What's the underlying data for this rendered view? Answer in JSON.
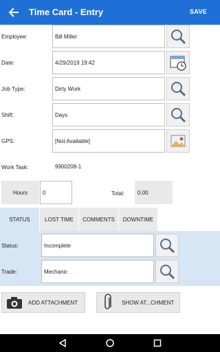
{
  "header": {
    "title": "Time Card - Entry",
    "save_label": "SAVE"
  },
  "form": {
    "employee": {
      "label": "Employee:",
      "value": "Bill Miller"
    },
    "date": {
      "label": "Date:",
      "value": "4/29/2019 19:42"
    },
    "job_type": {
      "label": "Job Type:",
      "value": "Dirty Work"
    },
    "shift": {
      "label": "Shift:",
      "value": "Days"
    },
    "gps": {
      "label": "GPS:",
      "value": "[Not Available]"
    },
    "work_task": {
      "label": "Work Task:",
      "value": "9900208-1"
    },
    "hours": {
      "label": "Hours",
      "value": "0"
    },
    "total": {
      "label": "Total:",
      "value": "0.00"
    }
  },
  "tabs": [
    "STATUS",
    "LOST TIME",
    "COMMENTS",
    "DOWNTIME"
  ],
  "status_panel": {
    "status": {
      "label": "Status:",
      "value": "Incomplete"
    },
    "trade": {
      "label": "Trade:",
      "value": "Mechanic"
    }
  },
  "actions": {
    "add_attachment": "ADD ATTACHMENT",
    "show_attachment": "SHOW AT...CHMENT"
  },
  "colors": {
    "appbar": "#1f70d6",
    "tab_active": "#d7e6f5"
  },
  "icons": [
    "back-arrow-icon",
    "magnifier-icon",
    "calendar-clock-icon",
    "map-picture-icon",
    "camera-icon",
    "paperclip-icon",
    "nav-back-icon",
    "nav-home-icon",
    "nav-recents-icon"
  ]
}
